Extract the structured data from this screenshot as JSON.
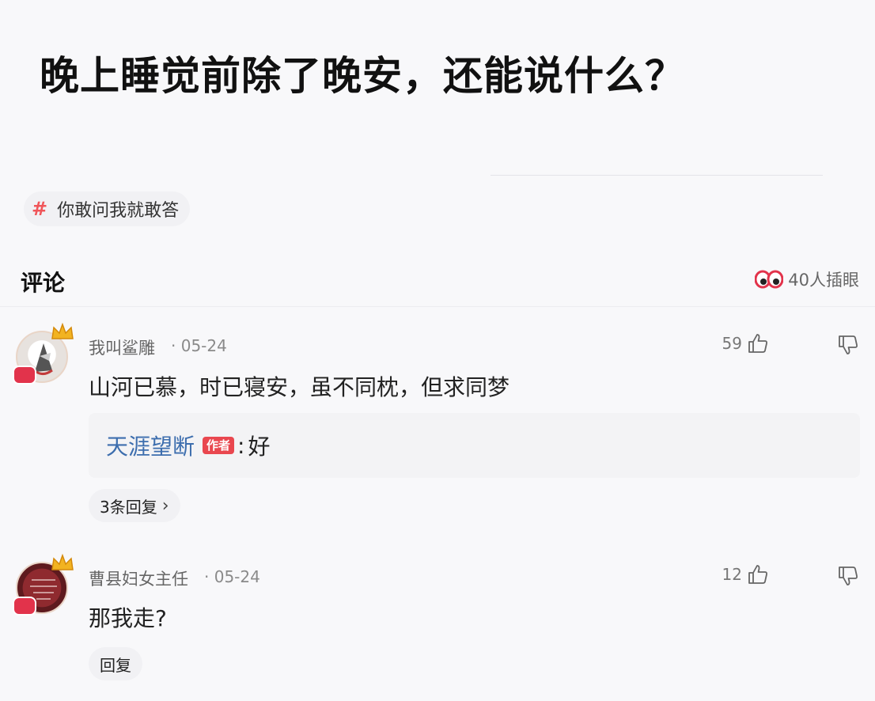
{
  "question": {
    "title": "晚上睡觉前除了晚安，还能说什么？"
  },
  "topic": {
    "label": "你敢问我就敢答",
    "icon": "hash-icon"
  },
  "comments_header": {
    "title": "评论",
    "peek_count_text": "40人插眼",
    "peek_icon": "eyes-icon"
  },
  "comments": [
    {
      "user": "我叫鲨雕",
      "date": "· 05-24",
      "likes": "59",
      "body": "山河已慕，时已寝安，虽不同枕，但求同梦",
      "reply": {
        "author": "天涯望断",
        "badge": "作者",
        "colon": ":",
        "text": "好"
      },
      "replies_button": "3条回复",
      "replies_chevron": "›"
    },
    {
      "user": "曹县妇女主任",
      "date": "· 05-24",
      "likes": "12",
      "body": "那我走?",
      "reply_button": "回复"
    }
  ],
  "colors": {
    "accent": "#f0565a",
    "link": "#3d6eae",
    "badge": "#e9474f"
  }
}
